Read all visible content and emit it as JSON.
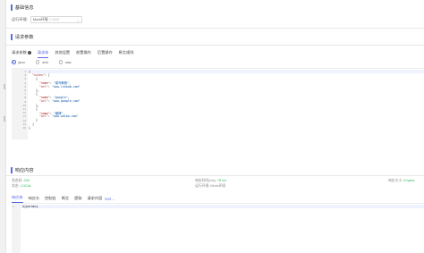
{
  "basic_info": {
    "title": "基础信息",
    "env_label": "运行环境:",
    "env_value": "Mock环境",
    "env_suffix": "3.1000"
  },
  "request_params": {
    "title": "请求参数",
    "tabs": [
      {
        "label": "请求参数"
      },
      {
        "label": "请求体"
      },
      {
        "label": "其他设置"
      },
      {
        "label": "前置操作"
      },
      {
        "label": "后置操作"
      },
      {
        "label": "断言规则"
      }
    ],
    "formats": [
      {
        "label": "json",
        "checked": true
      },
      {
        "label": "xml",
        "checked": false
      },
      {
        "label": "raw",
        "checked": false
      }
    ],
    "code_lines": [
      "{",
      "  \"sites\": [",
      "    {",
      "      \"name\": \"菜鸟教程\",",
      "      \"url\": \"www.runoob.com\"",
      "    },",
      "    {",
      "      \"name\": \"google\",",
      "      \"url\": \"www.google.com\"",
      "    },",
      "    {",
      "      \"name\": \"微博\",",
      "      \"url\": \"www.weibo.com\"",
      "    }",
      "  ]",
      "}"
    ]
  },
  "response": {
    "title": "响应内容",
    "status_code_label": "状态码:",
    "status_code": "200",
    "status_label": "状态:",
    "status": "LOCAL",
    "time_label": "响应时间(ms):",
    "time": "78 ms",
    "env_label": "运行环境:",
    "env": "Mock环境",
    "size_label": "响应大小:",
    "size": "8 bytes",
    "tabs": [
      {
        "label": "响应体"
      },
      {
        "label": "响应头"
      },
      {
        "label": "控制台"
      },
      {
        "label": "断言"
      },
      {
        "label": "提取"
      },
      {
        "label": "请求内容"
      }
    ],
    "format_select": "text",
    "body_line": "${params}"
  },
  "colors": {
    "accent": "#5b6ee1",
    "success": "#2fb85a"
  }
}
